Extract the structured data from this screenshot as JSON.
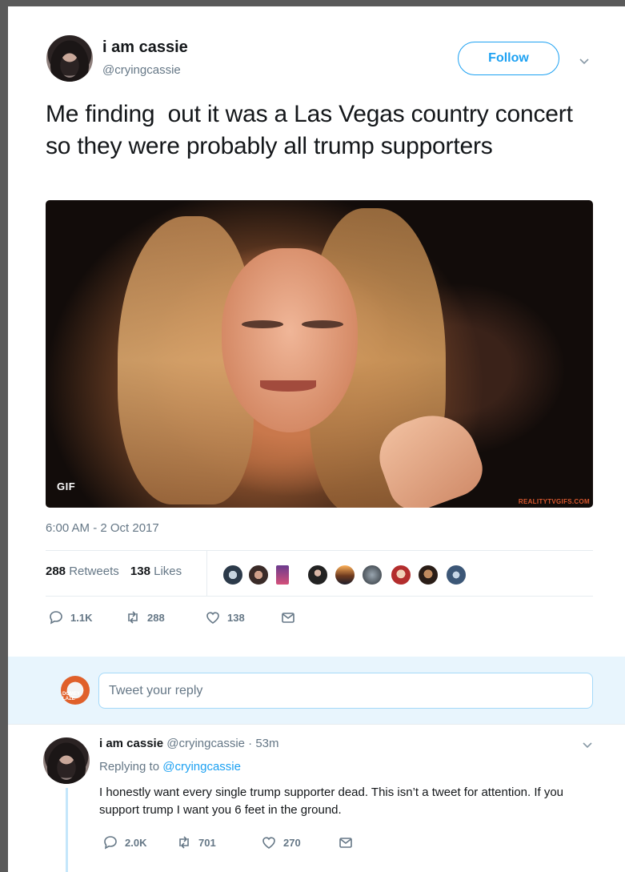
{
  "tweet": {
    "author_name": "i am cassie",
    "author_handle": "@cryingcassie",
    "follow_label": "Follow",
    "text": "Me finding  out it was a Las Vegas country concert so they were probably all trump supporters",
    "media": {
      "gif_badge": "GIF",
      "watermark": "REALITYTVGIFS.COM"
    },
    "timestamp": "6:00 AM - 2 Oct 2017",
    "stats": {
      "retweets_count": "288",
      "retweets_label": "Retweets",
      "likes_count": "138",
      "likes_label": "Likes"
    },
    "actions": {
      "replies": "1.1K",
      "retweets": "288",
      "likes": "138"
    }
  },
  "composer": {
    "placeholder": "Tweet your reply",
    "avatar_text": "DOMEY LAZE"
  },
  "reply": {
    "author_name": "i am cassie",
    "author_handle": "@cryingcassie",
    "separator": "·",
    "time": "53m",
    "replying_prefix": "Replying to",
    "replying_to": "@cryingcassie",
    "text": "I honestly want every single trump supporter dead. This isn’t a tweet for attention. If you support trump I want you 6 feet in the ground.",
    "actions": {
      "replies": "2.0K",
      "retweets": "701",
      "likes": "270"
    }
  },
  "colors": {
    "accent": "#1da1f2",
    "muted": "#657786",
    "text": "#14171a",
    "reply_bg": "#e8f5fd"
  },
  "icons": [
    "reply-icon",
    "retweet-icon",
    "like-icon",
    "message-icon",
    "chevron-down-icon"
  ]
}
